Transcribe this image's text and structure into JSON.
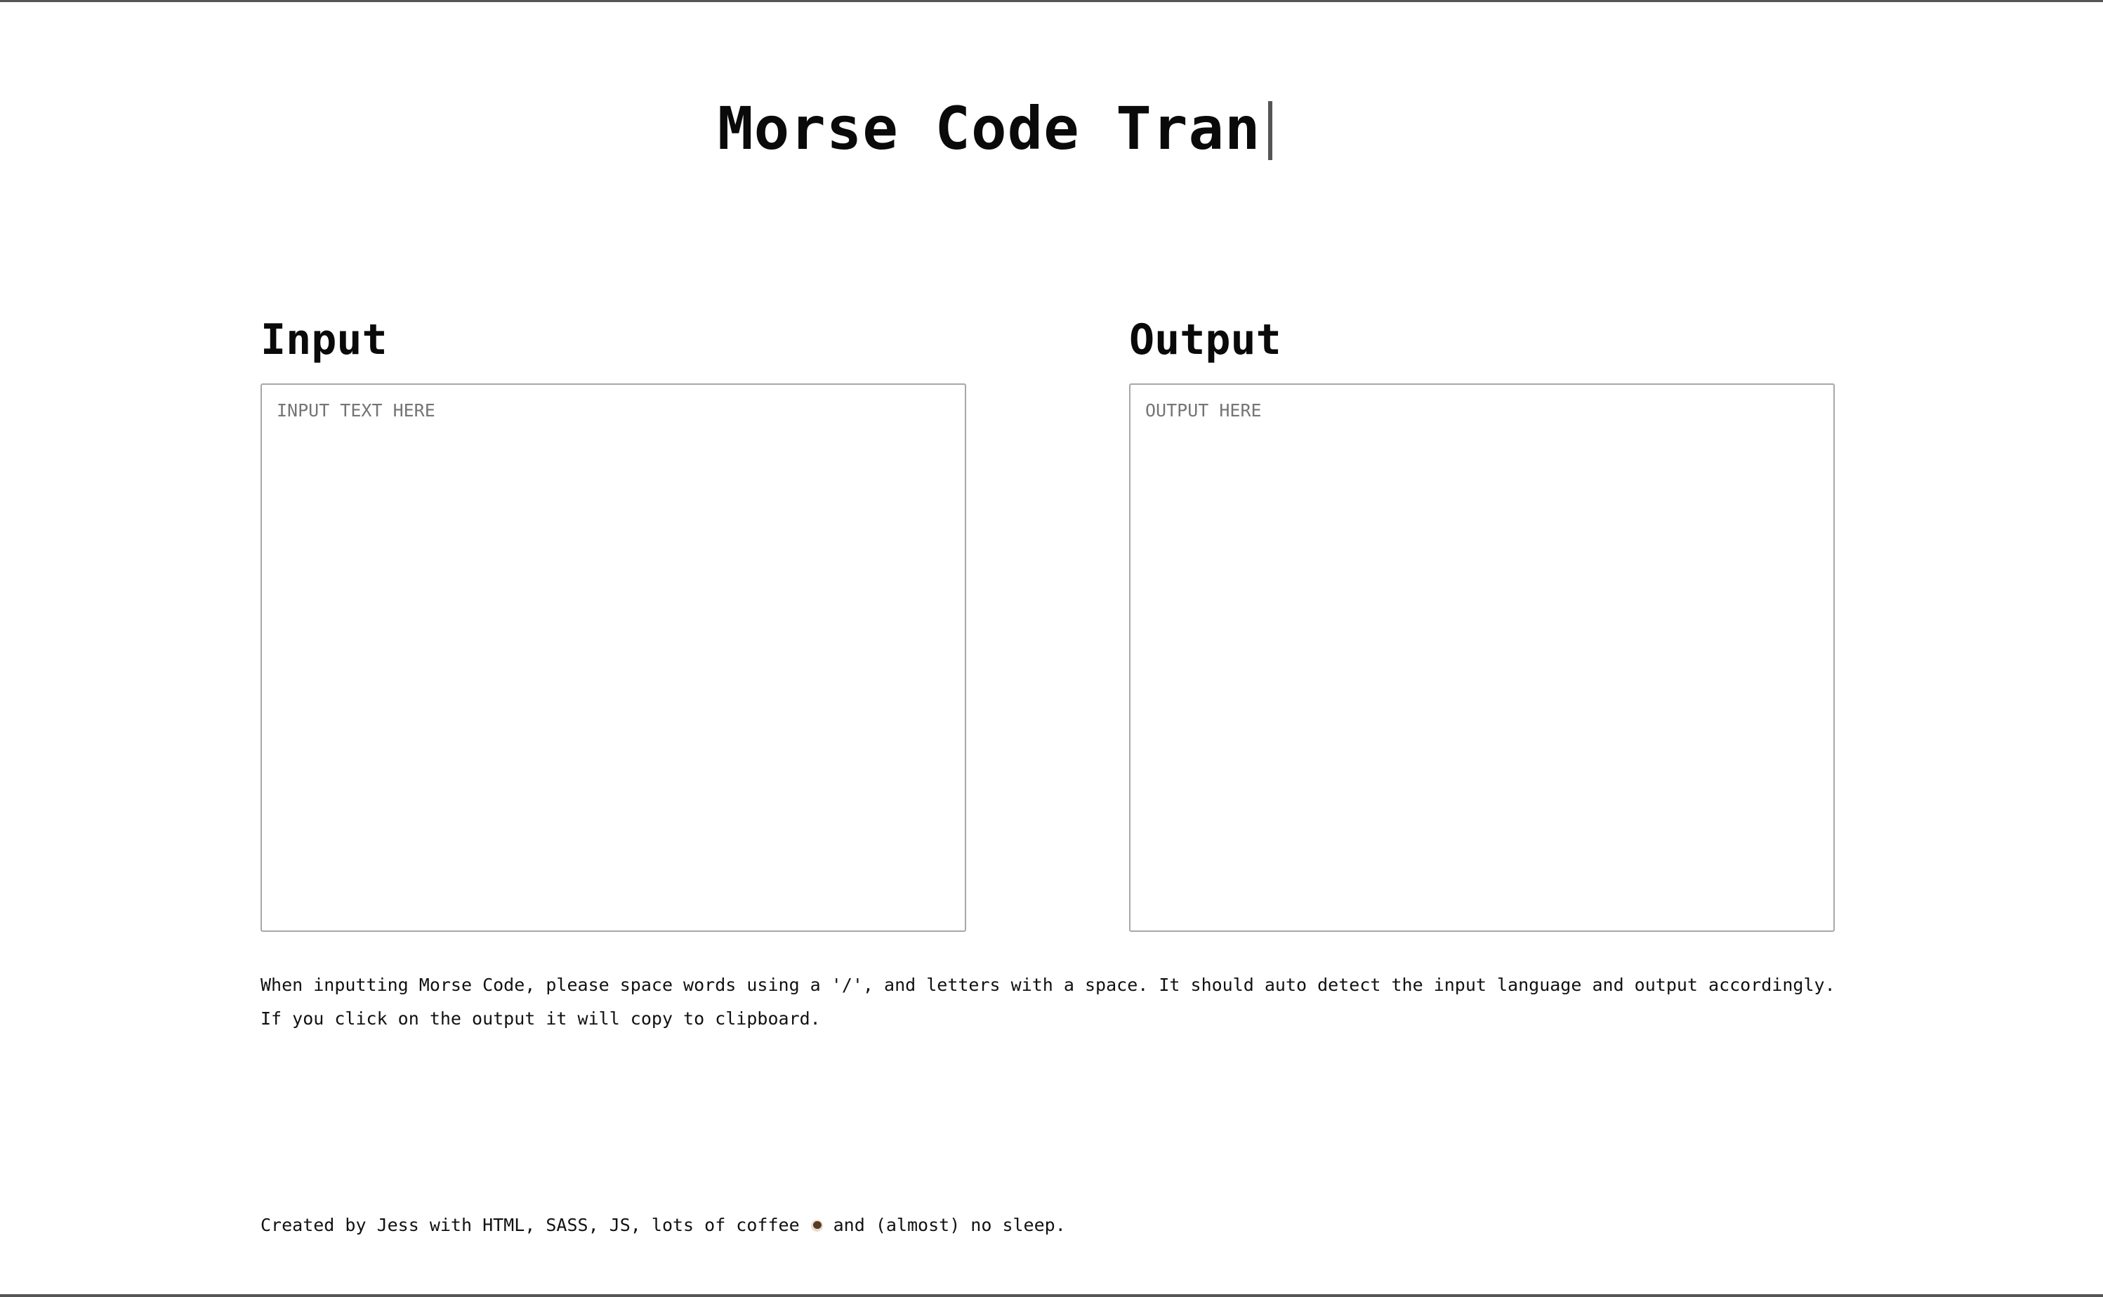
{
  "header": {
    "title": "Morse Code Tran"
  },
  "input_panel": {
    "heading": "Input",
    "placeholder": "INPUT TEXT HERE",
    "value": ""
  },
  "output_panel": {
    "heading": "Output",
    "placeholder": "OUTPUT HERE",
    "value": ""
  },
  "instructions": {
    "line1": "When inputting Morse Code, please space words using a '/', and letters with a space. It should auto detect the input language and output accordingly.",
    "line2": "If you click on the output it will copy to clipboard."
  },
  "footer": {
    "text_before_icon": "Created by Jess with HTML, SASS, JS, lots of coffee",
    "icon": "coffee-icon",
    "text_after_icon": "and (almost) no sleep."
  }
}
